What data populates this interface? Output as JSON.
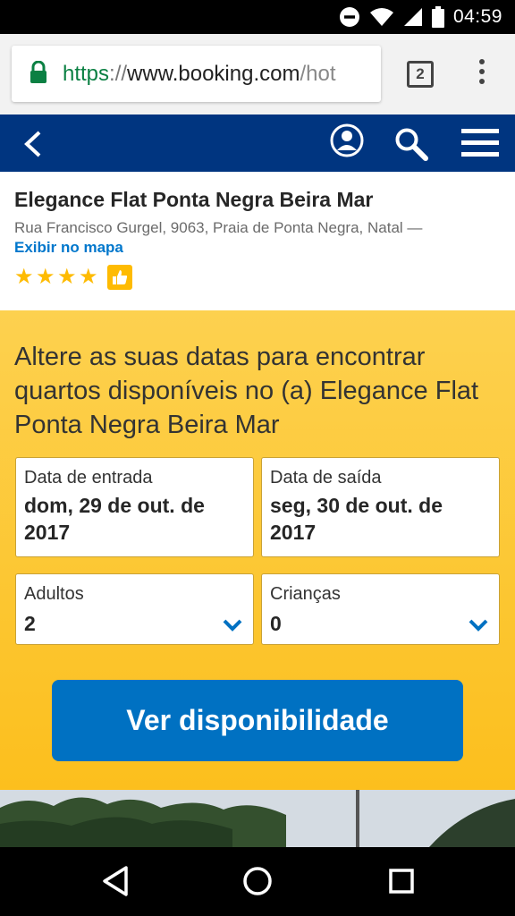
{
  "status_bar": {
    "time": "04:59",
    "icons": [
      "do-not-disturb-icon",
      "wifi-icon",
      "signal-icon",
      "battery-icon"
    ]
  },
  "browser": {
    "url_scheme": "https",
    "url_sep": "://",
    "url_host": "www.booking.com",
    "url_tail": "/hot",
    "tab_count": "2",
    "icons": [
      "lock-icon",
      "tabs-icon",
      "overflow-menu-icon"
    ]
  },
  "site_nav": {
    "icons": [
      "back-arrow-icon",
      "user-account-icon",
      "search-icon",
      "hamburger-menu-icon"
    ],
    "bg_color": "#003580"
  },
  "hotel": {
    "name": "Elegance Flat Ponta Negra Beira Mar",
    "address": "Rua Francisco Gurgel, 9063, Praia de Ponta Negra, Natal —",
    "map_link": "Exibir no mapa",
    "stars": 4,
    "badge_icon": "thumbs-up-icon"
  },
  "search": {
    "heading": "Altere as suas datas para encontrar quartos disponíveis no (a) Elegance Flat Ponta Negra Beira Mar",
    "checkin_label": "Data de entrada",
    "checkin_value": "dom, 29 de out. de 2017",
    "checkout_label": "Data de saída",
    "checkout_value": "seg, 30 de out. de 2017",
    "adults_label": "Adultos",
    "adults_value": "2",
    "children_label": "Crianças",
    "children_value": "0",
    "cta_label": "Ver disponibilidade",
    "panel_color": "#febb02",
    "cta_color": "#0071c2"
  },
  "android_nav": {
    "icons": [
      "back-triangle-icon",
      "home-circle-icon",
      "recents-square-icon"
    ]
  }
}
